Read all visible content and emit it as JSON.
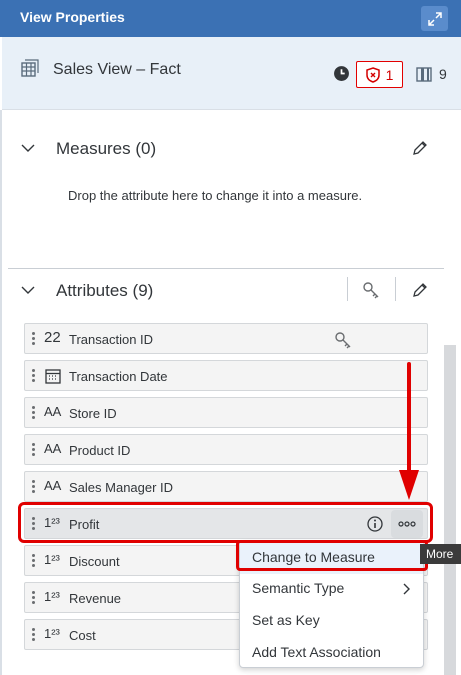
{
  "titlebar": {
    "title": "View Properties"
  },
  "header": {
    "view_title": "Sales View – Fact",
    "error_count": "1",
    "column_count": "9"
  },
  "measures": {
    "title": "Measures (0)",
    "drop_hint": "Drop the attribute here to change it into a measure."
  },
  "attributes": {
    "title": "Attributes (9)",
    "rows": [
      {
        "type": "22",
        "label": "Transaction ID"
      },
      {
        "type": "",
        "label": "Transaction Date"
      },
      {
        "type": "AA",
        "label": "Store ID"
      },
      {
        "type": "AA",
        "label": "Product ID"
      },
      {
        "type": "AA",
        "label": "Sales Manager ID"
      },
      {
        "type": "1²³",
        "label": "Profit"
      },
      {
        "type": "1²³",
        "label": "Discount"
      },
      {
        "type": "1²³",
        "label": "Revenue"
      },
      {
        "type": "1²³",
        "label": "Cost"
      }
    ]
  },
  "context_menu": {
    "items": [
      "Change to Measure",
      "Semantic Type",
      "Set as Key",
      "Add Text Association"
    ],
    "tooltip": "More"
  },
  "colors": {
    "accent": "#3b71b4",
    "highlight": "#e00000"
  }
}
